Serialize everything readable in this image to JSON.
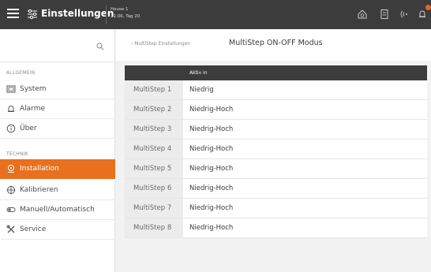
{
  "topbar": {
    "title": "Einstellungen",
    "house_name": "House 1",
    "house_date": "12.06, Tag 20"
  },
  "sidebar": {
    "sections": [
      {
        "label": "ALLGEMEIN"
      },
      {
        "label": "TECHNIK"
      }
    ],
    "items": [
      {
        "label": "System",
        "icon": "system-icon"
      },
      {
        "label": "Alarme",
        "icon": "bell-icon"
      },
      {
        "label": "Über",
        "icon": "info-icon"
      },
      {
        "label": "Installation",
        "icon": "installation-icon",
        "active": true
      },
      {
        "label": "Kalibrieren",
        "icon": "calibrate-icon"
      },
      {
        "label": "Manuell/Automatisch",
        "icon": "toggle-icon"
      },
      {
        "label": "Service",
        "icon": "tools-icon"
      }
    ]
  },
  "main": {
    "breadcrumb": "‹  MultiStep Einstellungen",
    "title": "MultiStep ON-OFF Modus",
    "table": {
      "headers": [
        "",
        "Aktiv in"
      ],
      "rows": [
        [
          "MultiStep 1",
          "Niedrig"
        ],
        [
          "MultiStep 2",
          "Niedrig-Hoch"
        ],
        [
          "MultiStep 3",
          "Niedrig-Hoch"
        ],
        [
          "MultiStep 4",
          "Niedrig-Hoch"
        ],
        [
          "MultiStep 5",
          "Niedrig-Hoch"
        ],
        [
          "MultiStep 6",
          "Niedrig-Hoch"
        ],
        [
          "MultiStep 7",
          "Niedrig-Hoch"
        ],
        [
          "MultiStep 8",
          "Niedrig-Hoch"
        ]
      ]
    }
  },
  "colors": {
    "accent": "#e8701e",
    "topbar": "#3c3c3c"
  }
}
